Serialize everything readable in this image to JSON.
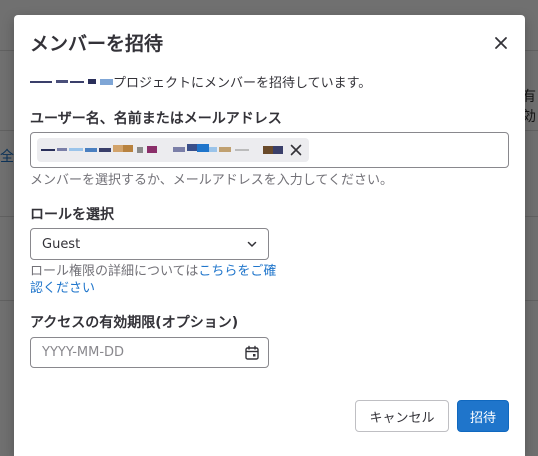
{
  "background": {
    "fragment_right": "有効",
    "fragment_left": "全て"
  },
  "modal": {
    "title": "メンバーを招待",
    "close_icon": "close-icon",
    "intro_text": "プロジェクトにメンバーを招待しています。",
    "members": {
      "label": "ユーザー名、名前またはメールアドレス",
      "hint": "メンバーを選択するか、メールアドレスを入力してください。",
      "token_remove_icon": "close-icon"
    },
    "role": {
      "label": "ロールを選択",
      "selected": "Guest",
      "chevron_icon": "chevron-down-icon",
      "hint_prefix": "ロール権限の詳細については",
      "hint_link": "こちらをご確認ください"
    },
    "expiry": {
      "label": "アクセスの有効期限(オプション)",
      "placeholder": "YYYY-MM-DD",
      "calendar_icon": "calendar-icon"
    },
    "buttons": {
      "cancel": "キャンセル",
      "invite": "招待"
    }
  },
  "colors": {
    "primary": "#1f75cb",
    "text": "#333238",
    "muted": "#737278",
    "border": "#89888d"
  }
}
